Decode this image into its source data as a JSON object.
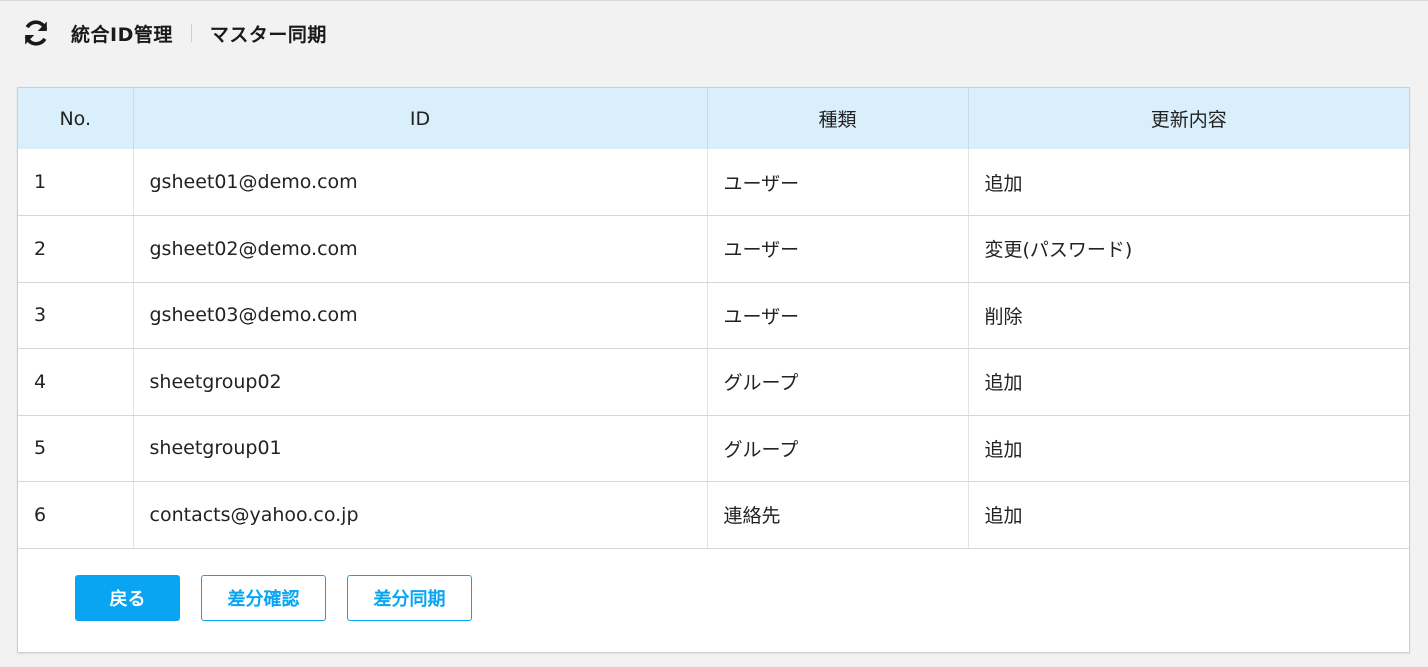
{
  "header": {
    "app_title": "統合ID管理",
    "page_title": "マスター同期",
    "icon": "sync-icon"
  },
  "table": {
    "columns": [
      "No.",
      "ID",
      "種類",
      "更新内容"
    ],
    "rows": [
      {
        "no": "1",
        "id": "gsheet01@demo.com",
        "type": "ユーザー",
        "change": "追加"
      },
      {
        "no": "2",
        "id": "gsheet02@demo.com",
        "type": "ユーザー",
        "change": "変更(パスワード)"
      },
      {
        "no": "3",
        "id": "gsheet03@demo.com",
        "type": "ユーザー",
        "change": "削除"
      },
      {
        "no": "4",
        "id": "sheetgroup02",
        "type": "グループ",
        "change": "追加"
      },
      {
        "no": "5",
        "id": "sheetgroup01",
        "type": "グループ",
        "change": "追加"
      },
      {
        "no": "6",
        "id": "contacts@yahoo.co.jp",
        "type": "連絡先",
        "change": "追加"
      }
    ]
  },
  "actions": {
    "back_label": "戻る",
    "diff_check_label": "差分確認",
    "diff_sync_label": "差分同期"
  },
  "colors": {
    "accent": "#0aa5f2",
    "header_bg": "#d9effb",
    "page_bg": "#f2f2f2"
  }
}
